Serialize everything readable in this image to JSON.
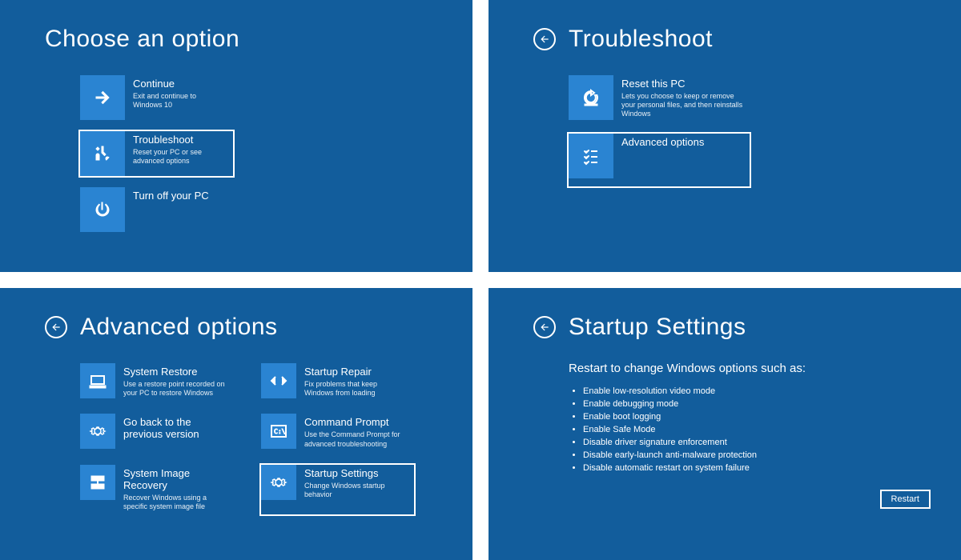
{
  "panel1": {
    "title": "Choose an option",
    "options": [
      {
        "title": "Continue",
        "desc": "Exit and continue to Windows 10"
      },
      {
        "title": "Troubleshoot",
        "desc": "Reset your PC or see advanced options"
      },
      {
        "title": "Turn off your PC",
        "desc": ""
      }
    ]
  },
  "panel2": {
    "title": "Troubleshoot",
    "options": [
      {
        "title": "Reset this PC",
        "desc": "Lets you choose to keep or remove your personal files, and then reinstalls Windows"
      },
      {
        "title": "Advanced options",
        "desc": ""
      }
    ]
  },
  "panel3": {
    "title": "Advanced options",
    "options": [
      {
        "title": "System Restore",
        "desc": "Use a restore point recorded on your PC to restore Windows"
      },
      {
        "title": "Startup Repair",
        "desc": "Fix problems that keep Windows from loading"
      },
      {
        "title": "Go back to the previous version",
        "desc": ""
      },
      {
        "title": "Command Prompt",
        "desc": "Use the Command Prompt for advanced troubleshooting"
      },
      {
        "title": "System Image Recovery",
        "desc": "Recover Windows using a specific system image file"
      },
      {
        "title": "Startup Settings",
        "desc": "Change Windows startup behavior"
      }
    ]
  },
  "panel4": {
    "title": "Startup Settings",
    "subhead": "Restart to change Windows options such as:",
    "bullets": [
      "Enable low-resolution video mode",
      "Enable debugging mode",
      "Enable boot logging",
      "Enable Safe Mode",
      "Disable driver signature enforcement",
      "Disable early-launch anti-malware protection",
      "Disable automatic restart on system failure"
    ],
    "restart_label": "Restart"
  }
}
